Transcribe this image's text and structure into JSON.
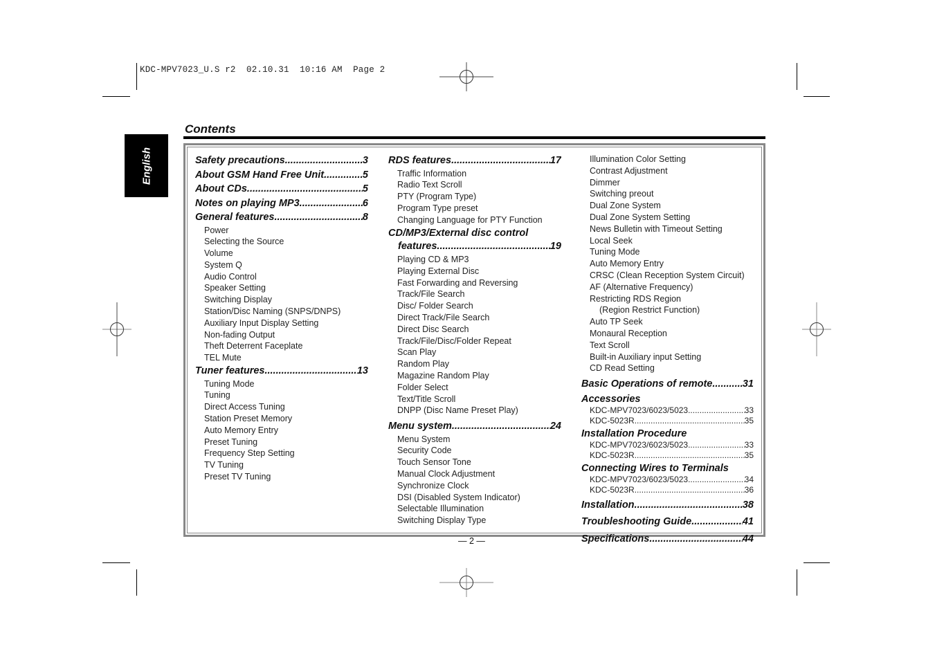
{
  "print_header": {
    "file": "KDC-MPV7023_U.S r2",
    "date": "02.10.31",
    "time": "10:16 AM",
    "page": "Page 2"
  },
  "language_tab": "English",
  "title": "Contents",
  "page_number": "— 2 —",
  "columns": [
    {
      "items": [
        {
          "type": "entry",
          "label": "Safety precautions",
          "page": "3"
        },
        {
          "type": "entry",
          "label": "About GSM Hand Free Unit",
          "page": "5"
        },
        {
          "type": "entry",
          "label": "About CDs",
          "page": "5"
        },
        {
          "type": "entry",
          "label": "Notes on playing MP3 ",
          "page": "6"
        },
        {
          "type": "entry",
          "label": "General features ",
          "page": "8"
        },
        {
          "type": "sub",
          "label": "Power"
        },
        {
          "type": "sub",
          "label": "Selecting the Source"
        },
        {
          "type": "sub",
          "label": "Volume"
        },
        {
          "type": "sub",
          "label": "System Q"
        },
        {
          "type": "sub",
          "label": "Audio Control"
        },
        {
          "type": "sub",
          "label": "Speaker Setting"
        },
        {
          "type": "sub",
          "label": "Switching Display"
        },
        {
          "type": "sub",
          "label": "Station/Disc Naming (SNPS/DNPS)"
        },
        {
          "type": "sub",
          "label": "Auxiliary Input Display Setting"
        },
        {
          "type": "sub",
          "label": "Non-fading Output"
        },
        {
          "type": "sub",
          "label": "Theft Deterrent Faceplate"
        },
        {
          "type": "sub",
          "label": "TEL Mute"
        },
        {
          "type": "entry",
          "label": "Tuner features",
          "page": "13"
        },
        {
          "type": "sub",
          "label": "Tuning Mode"
        },
        {
          "type": "sub",
          "label": "Tuning"
        },
        {
          "type": "sub",
          "label": "Direct Access Tuning"
        },
        {
          "type": "sub",
          "label": "Station Preset Memory"
        },
        {
          "type": "sub",
          "label": "Auto Memory Entry"
        },
        {
          "type": "sub",
          "label": "Preset Tuning"
        },
        {
          "type": "sub",
          "label": "Frequency Step Setting"
        },
        {
          "type": "sub",
          "label": "TV Tuning"
        },
        {
          "type": "sub",
          "label": "Preset TV Tuning"
        }
      ]
    },
    {
      "items": [
        {
          "type": "entry",
          "label": "RDS features",
          "page": "17"
        },
        {
          "type": "sub",
          "label": "Traffic Information"
        },
        {
          "type": "sub",
          "label": "Radio Text Scroll"
        },
        {
          "type": "sub",
          "label": "PTY (Program Type)"
        },
        {
          "type": "sub",
          "label": "Program Type preset"
        },
        {
          "type": "sub",
          "label": "Changing Language for PTY Function"
        },
        {
          "type": "heading",
          "label": "CD/MP3/External disc control"
        },
        {
          "type": "entry-cont",
          "label": "features ",
          "page": "19"
        },
        {
          "type": "sub",
          "label": "Playing CD & MP3"
        },
        {
          "type": "sub",
          "label": "Playing External Disc"
        },
        {
          "type": "sub",
          "label": "Fast Forwarding and Reversing"
        },
        {
          "type": "sub",
          "label": "Track/File Search"
        },
        {
          "type": "sub",
          "label": "Disc/ Folder Search"
        },
        {
          "type": "sub",
          "label": "Direct Track/File Search"
        },
        {
          "type": "sub",
          "label": "Direct Disc Search"
        },
        {
          "type": "sub",
          "label": "Track/File/Disc/Folder Repeat"
        },
        {
          "type": "sub",
          "label": "Scan Play"
        },
        {
          "type": "sub",
          "label": "Random Play"
        },
        {
          "type": "sub",
          "label": "Magazine Random Play"
        },
        {
          "type": "sub",
          "label": "Folder Select"
        },
        {
          "type": "sub",
          "label": "Text/Title Scroll"
        },
        {
          "type": "sub",
          "label": "DNPP (Disc Name Preset Play)"
        },
        {
          "type": "entry",
          "label": "Menu system",
          "page": "24"
        },
        {
          "type": "sub",
          "label": "Menu System"
        },
        {
          "type": "sub",
          "label": "Security Code"
        },
        {
          "type": "sub",
          "label": "Touch Sensor Tone"
        },
        {
          "type": "sub",
          "label": "Manual Clock Adjustment"
        },
        {
          "type": "sub",
          "label": "Synchronize Clock"
        },
        {
          "type": "sub",
          "label": "DSI (Disabled System Indicator)"
        },
        {
          "type": "sub",
          "label": "Selectable Illumination"
        },
        {
          "type": "sub",
          "label": "Switching Display Type"
        }
      ]
    },
    {
      "items": [
        {
          "type": "sub",
          "label": "Illumination Color Setting"
        },
        {
          "type": "sub",
          "label": "Contrast Adjustment"
        },
        {
          "type": "sub",
          "label": "Dimmer"
        },
        {
          "type": "sub",
          "label": "Switching preout"
        },
        {
          "type": "sub",
          "label": "Dual Zone System"
        },
        {
          "type": "sub",
          "label": "Dual Zone System Setting"
        },
        {
          "type": "sub",
          "label": "News Bulletin with Timeout Setting"
        },
        {
          "type": "sub",
          "label": "Local Seek"
        },
        {
          "type": "sub",
          "label": "Tuning Mode"
        },
        {
          "type": "sub",
          "label": "Auto Memory Entry"
        },
        {
          "type": "sub",
          "label": "CRSC (Clean Reception System Circuit)"
        },
        {
          "type": "sub",
          "label": "AF (Alternative Frequency)"
        },
        {
          "type": "sub",
          "label": "Restricting RDS Region"
        },
        {
          "type": "sub2",
          "label": "(Region Restrict Function)"
        },
        {
          "type": "sub",
          "label": "Auto TP Seek"
        },
        {
          "type": "sub",
          "label": "Monaural Reception"
        },
        {
          "type": "sub",
          "label": "Text Scroll"
        },
        {
          "type": "sub",
          "label": "Built-in Auxiliary input Setting"
        },
        {
          "type": "sub",
          "label": "CD Read Setting"
        },
        {
          "type": "entry",
          "label": "Basic Operations of remote",
          "page": "31"
        },
        {
          "type": "heading",
          "label": "Accessories"
        },
        {
          "type": "small",
          "label": "KDC-MPV7023/6023/5023",
          "page": "33"
        },
        {
          "type": "small",
          "label": "KDC-5023R ",
          "page": "35"
        },
        {
          "type": "heading",
          "label": "Installation Procedure"
        },
        {
          "type": "small",
          "label": "KDC-MPV7023/6023/5023",
          "page": "33"
        },
        {
          "type": "small",
          "label": "KDC-5023R ",
          "page": "35"
        },
        {
          "type": "heading",
          "label": "Connecting Wires to Terminals"
        },
        {
          "type": "small",
          "label": "KDC-MPV7023/6023/5023",
          "page": "34"
        },
        {
          "type": "small",
          "label": "KDC-5023R ",
          "page": "36"
        },
        {
          "type": "entry",
          "label": "Installation ",
          "page": "38"
        },
        {
          "type": "entry",
          "label": "Troubleshooting Guide ",
          "page": "41"
        },
        {
          "type": "entry",
          "label": "Specifications ",
          "page": "44"
        }
      ]
    }
  ]
}
